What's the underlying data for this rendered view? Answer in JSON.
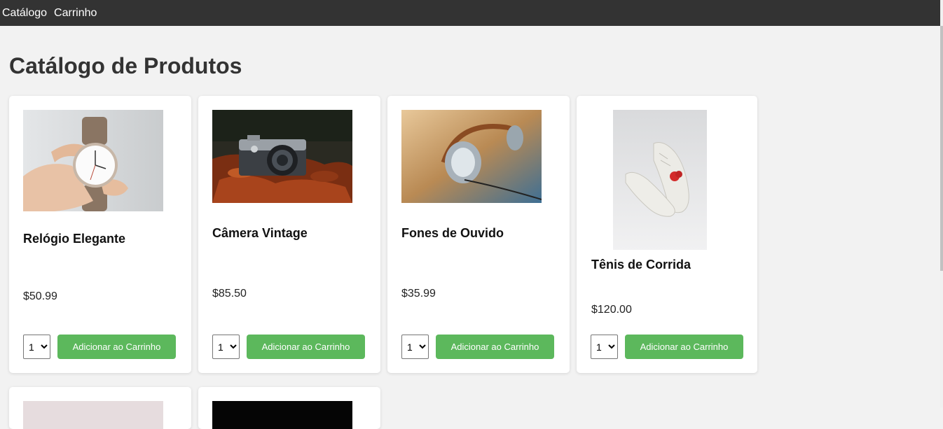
{
  "nav": {
    "items": [
      "Catálogo",
      "Carrinho"
    ]
  },
  "page": {
    "title": "Catálogo de Produtos"
  },
  "products": [
    {
      "name": "Relógio Elegante",
      "price": "$50.99",
      "quantity": "1",
      "add_label": "Adicionar ao Carrinho",
      "image": "wristwatch-in-hand-photo"
    },
    {
      "name": "Câmera Vintage",
      "price": "$85.50",
      "quantity": "1",
      "add_label": "Adicionar ao Carrinho",
      "image": "vintage-camera-on-leaves-photo"
    },
    {
      "name": "Fones de Ouvido",
      "price": "$35.99",
      "quantity": "1",
      "add_label": "Adicionar ao Carrinho",
      "image": "headphones-photo"
    },
    {
      "name": "Tênis de Corrida",
      "price": "$120.00",
      "quantity": "1",
      "add_label": "Adicionar ao Carrinho",
      "image": "white-sneakers-photo"
    }
  ],
  "colors": {
    "nav_bg": "#333333",
    "page_bg": "#f2f2f2",
    "button_bg": "#5cb85c",
    "title": "#333333"
  }
}
